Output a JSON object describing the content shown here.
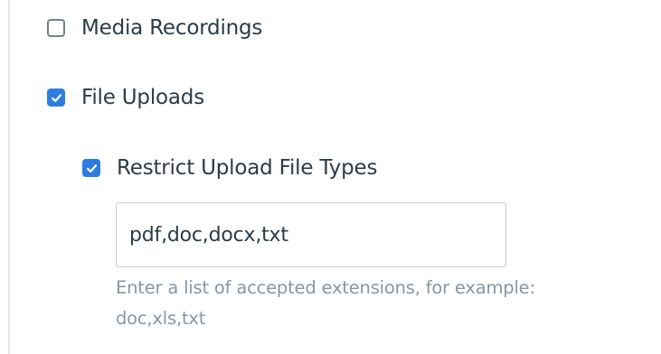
{
  "submission_types": {
    "media_recordings": {
      "label": "Media Recordings",
      "checked": false
    },
    "file_uploads": {
      "label": "File Uploads",
      "checked": true
    },
    "restrict_file_types": {
      "label": "Restrict Upload File Types",
      "checked": true,
      "value": "pdf,doc,docx,txt",
      "hint": "Enter a list of accepted extensions, for example: doc,xls,txt"
    }
  },
  "colors": {
    "checkbox_checked": "#2d7de0",
    "checkbox_border": "#73818c",
    "text": "#2d3b45",
    "hint": "#8b969e"
  },
  "icons": {
    "checkmark": "checkmark-icon"
  }
}
